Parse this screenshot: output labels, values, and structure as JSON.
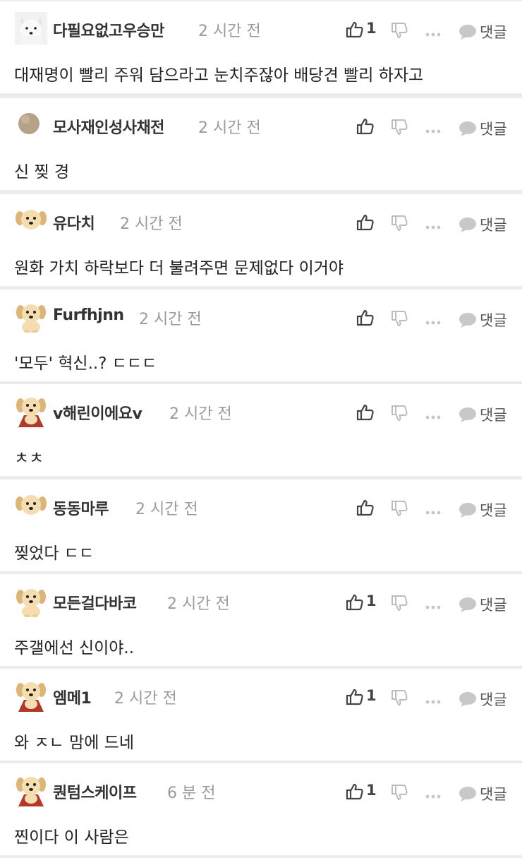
{
  "comments": [
    {
      "author": "다필요없고우승만",
      "time": "2 시간 전",
      "likes": "1",
      "text": "대재명이 빨리 주워 담으라고 눈치주잖아 배당견 빨리 하자고",
      "avatar": "white-dog",
      "reply_label": "댓글"
    },
    {
      "author": "모사재인성사채전",
      "time": "2 시간 전",
      "likes": "",
      "text": "신 찢 경",
      "avatar": "tan-circle",
      "reply_label": "댓글"
    },
    {
      "author": "유다치",
      "time": "2 시간 전",
      "likes": "",
      "text": "원화 가치 하락보다 더 불려주면 문제없다 이거야",
      "avatar": "puppy-face",
      "reply_label": "댓글"
    },
    {
      "author": "Furfhjnn",
      "time": "2 시간 전",
      "likes": "",
      "text": "'모두' 혁신..? ㄷㄷㄷ",
      "avatar": "puppy",
      "reply_label": "댓글"
    },
    {
      "author": "v해린이에요v",
      "time": "2 시간 전",
      "likes": "",
      "text": "ㅊㅊ",
      "avatar": "puppy-cape",
      "reply_label": "댓글"
    },
    {
      "author": "동동마루",
      "time": "2 시간 전",
      "likes": "",
      "text": "찢었다 ㄷㄷ",
      "avatar": "puppy-face",
      "reply_label": "댓글"
    },
    {
      "author": "모든걸다바코",
      "time": "2 시간 전",
      "likes": "1",
      "text": "주갤에선 신이야..",
      "avatar": "puppy",
      "reply_label": "댓글"
    },
    {
      "author": "엠메1",
      "time": "2 시간 전",
      "likes": "1",
      "text": "와 ㅈㄴ 맘에 드네",
      "avatar": "puppy-cape",
      "reply_label": "댓글"
    },
    {
      "author": "퀀텀스케이프",
      "time": "6 분 전",
      "likes": "1",
      "text": "찐이다 이 사람은",
      "avatar": "puppy-cape",
      "reply_label": "댓글"
    }
  ],
  "icons": {
    "like": "thumbs-up-icon",
    "dislike": "thumbs-down-icon",
    "more": "more-dots-icon",
    "reply": "speech-bubble-icon"
  },
  "colors": {
    "background": "#ececec",
    "card": "#ffffff",
    "author": "#333333",
    "time": "#9a9a9a",
    "text": "#222222",
    "icon": "#444444",
    "icon_muted": "#bdbdbd"
  }
}
